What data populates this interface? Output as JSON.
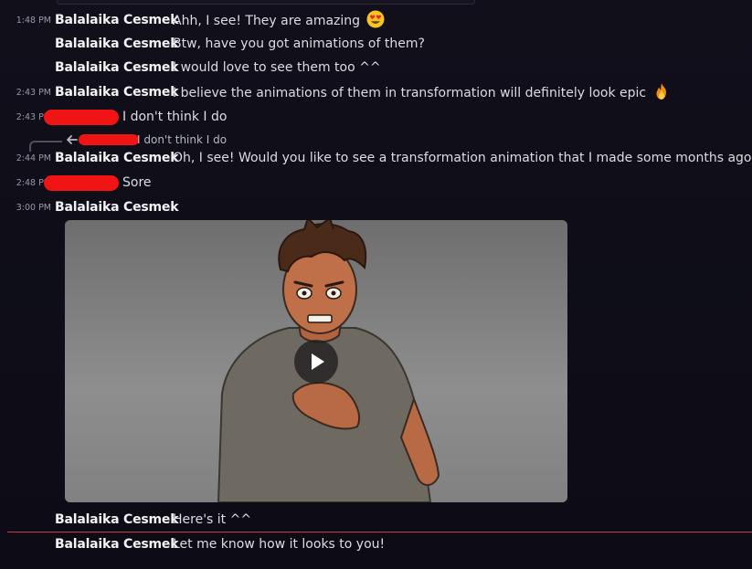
{
  "messages": [
    {
      "time": "1:48 PM",
      "author": "Balalaika Cesmek",
      "text": "Ahh, I see! They are amazing",
      "emoji": "heart-eyes-emoji"
    },
    {
      "time": "",
      "author": "Balalaika Cesmek",
      "text": "Btw, have you got animations of them?"
    },
    {
      "time": "",
      "author": "Balalaika Cesmek",
      "text": "I would love to see them too ^^"
    },
    {
      "time": "2:43 PM",
      "author": "Balalaika Cesmek",
      "text": "I believe the animations of them in transformation will definitely look epic",
      "emoji": "fire-emoji"
    },
    {
      "time": "2:43 PM",
      "author": "",
      "text": "I don't think I do",
      "author_redacted": true
    },
    {
      "time": "2:44 PM",
      "author": "Balalaika Cesmek",
      "text": "Oh, I see! Would you like to see a transformation animation that I made some months ago?"
    },
    {
      "time": "2:48 PM",
      "author": "",
      "text": "Sore",
      "author_redacted": true
    },
    {
      "time": "3:00 PM",
      "author": "Balalaika Cesmek",
      "text": ""
    },
    {
      "time": "",
      "author": "Balalaika Cesmek",
      "text": "Here's it ^^"
    },
    {
      "time": "",
      "author": "Balalaika Cesmek",
      "text": "Let me know how it looks to you!"
    }
  ],
  "reply_preview": {
    "text": "I don't think I do",
    "icon": "reply-arrow-icon"
  },
  "video": {
    "icon": "play-icon"
  },
  "colors": {
    "background": "#0e0d17",
    "author": "#f2f3f5",
    "text": "#dbdee1",
    "timestamp": "#949ba4",
    "redaction": "#f01414",
    "new_divider": "#c8393d"
  }
}
